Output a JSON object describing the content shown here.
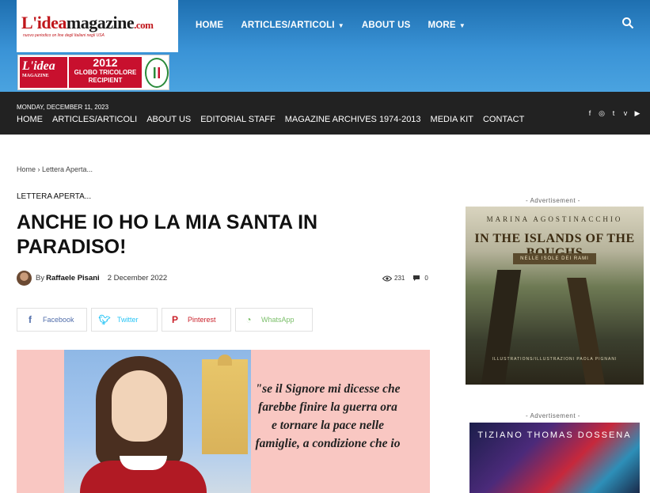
{
  "site": {
    "logo_main": "L'idea",
    "logo_second": "magazine",
    "logo_tld": ".com",
    "logo_tagline": "nuovo periodico on line degli Italiani negli USA",
    "banner": {
      "left": "L'idea",
      "left_sub": "MAGAZINE",
      "year": "2012",
      "award": "GLOBO TRICOLORE",
      "recipient": "RECIPIENT"
    }
  },
  "topnav": {
    "items": [
      {
        "label": "HOME",
        "chevron": false
      },
      {
        "label": "ARTICLES/ARTICOLI",
        "chevron": true
      },
      {
        "label": "ABOUT US",
        "chevron": false
      },
      {
        "label": "MORE",
        "chevron": true
      }
    ]
  },
  "darkbar": {
    "date": "MONDAY, DECEMBER 11, 2023",
    "items": [
      "HOME",
      "ARTICLES/ARTICOLI",
      "ABOUT US",
      "EDITORIAL STAFF",
      "MAGAZINE ARCHIVES 1974-2013",
      "MEDIA KIT",
      "CONTACT"
    ],
    "social": [
      "f",
      "◎",
      "t",
      "v",
      "▶"
    ]
  },
  "article": {
    "breadcrumb": "Home › Lettera Aperta...",
    "category": "LETTERA APERTA...",
    "title": "ANCHE IO HO LA MIA SANTA IN PARADISO!",
    "by": "By",
    "author": "Raffaele Pisani",
    "date": "2 December 2022",
    "views": "231",
    "comments": "0",
    "quote": "\"se il Signore mi dicesse che farebbe finire la guerra ora e tornare la pace nelle famiglie, a condizione che io"
  },
  "share": {
    "facebook": "Facebook",
    "twitter": "Twitter",
    "pinterest": "Pinterest",
    "whatsapp": "WhatsApp"
  },
  "sidebar": {
    "ad_label": "- Advertisement -",
    "ad1": {
      "author": "MARINA AGOSTINACCHIO",
      "title": "IN THE ISLANDS OF THE BOUGHS",
      "subtitle": "NELLE ISOLE DEI RAMI",
      "credit": "ILLUSTRATIONS/ILLUSTRAZIONI PAOLA PIGNANI"
    },
    "ad2": {
      "author": "TIZIANO THOMAS DOSSENA"
    }
  },
  "colors": {
    "header_blue": "#3a93d6",
    "dark_bar": "#222222",
    "facebook": "#516eab",
    "twitter": "#29c5f6",
    "pinterest": "#ca212a",
    "whatsapp": "#7bbf6a"
  }
}
